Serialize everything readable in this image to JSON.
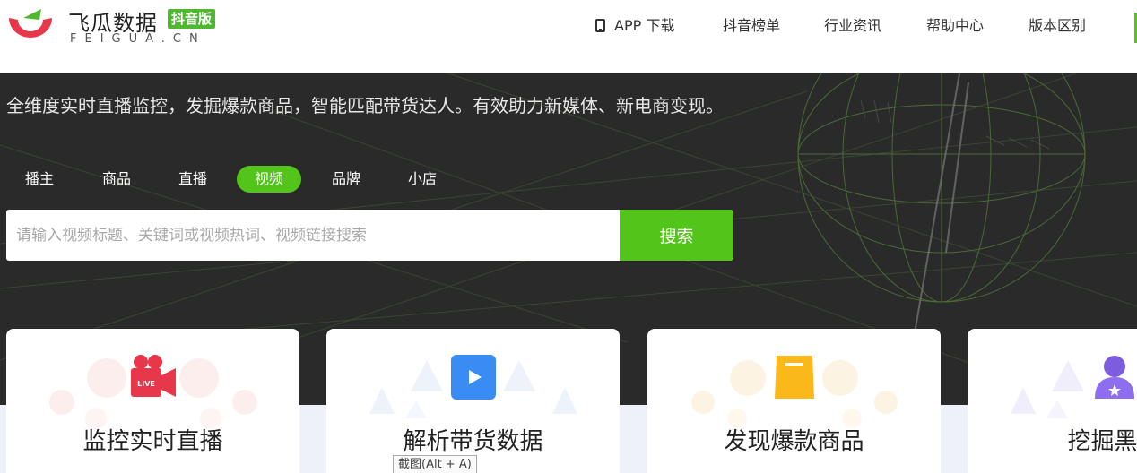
{
  "header": {
    "logo_cn": "飞瓜数据",
    "logo_badge": "抖音版",
    "logo_en": "FEIGUA.CN",
    "nav": {
      "app_download": "APP 下载",
      "douyin_rank": "抖音榜单",
      "industry_news": "行业资讯",
      "help_center": "帮助中心",
      "version_diff": "版本区别"
    }
  },
  "hero": {
    "slogan": "全维度实时直播监控，发掘爆款商品，智能匹配带货达人。有效助力新媒体、新电商变现。",
    "tabs": [
      {
        "label": "播主"
      },
      {
        "label": "商品"
      },
      {
        "label": "直播"
      },
      {
        "label": "视频"
      },
      {
        "label": "品牌"
      },
      {
        "label": "小店"
      }
    ],
    "active_tab": "视频",
    "search": {
      "placeholder": "请输入视频标题、关键词或视频热词、视频链接搜索",
      "button": "搜索"
    }
  },
  "features": [
    {
      "title": "监控实时直播",
      "icon": "live-camera-icon",
      "badge": "LIVE"
    },
    {
      "title": "解析带货数据",
      "icon": "play-video-icon"
    },
    {
      "title": "发现爆款商品",
      "icon": "shopping-bag-icon"
    },
    {
      "title": "挖掘黑马",
      "icon": "user-star-icon"
    }
  ],
  "tooltip": "截图(Alt + A)",
  "colors": {
    "accent": "#52c41a",
    "hero_bg": "#2a2a2a",
    "logo_red": "#e8364a"
  }
}
